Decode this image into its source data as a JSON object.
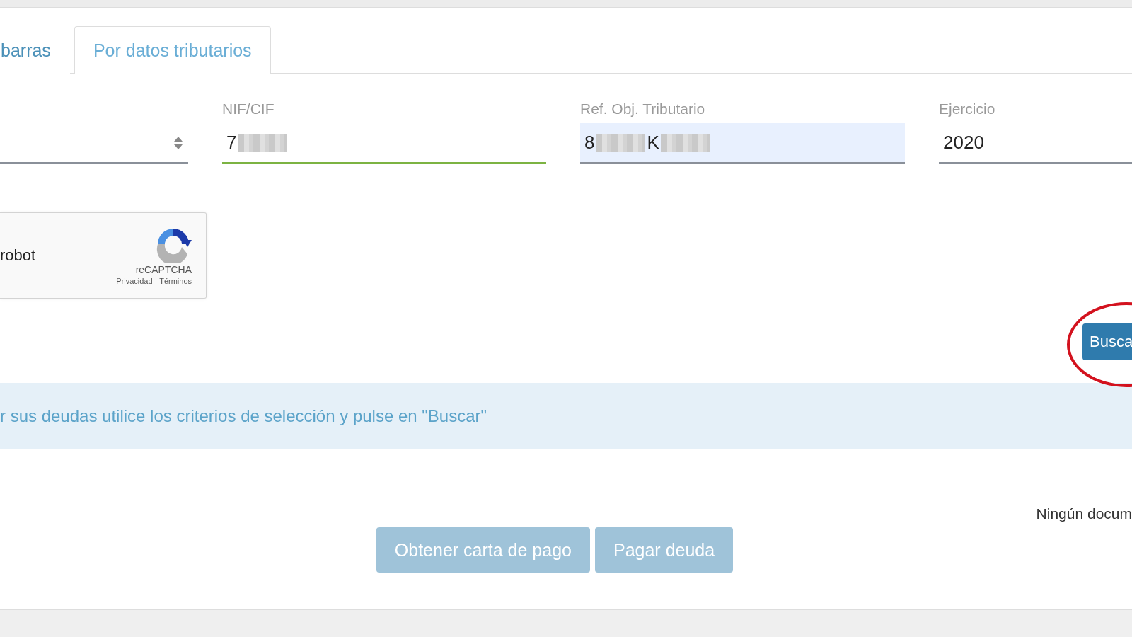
{
  "tabs": [
    {
      "label": "barras",
      "selected": false
    },
    {
      "label": "Por datos tributarios",
      "selected": true
    }
  ],
  "fields": [
    {
      "kind": "select",
      "valid": false,
      "focused": false
    },
    {
      "kind": "input",
      "label": "NIF/CIF",
      "valid": true,
      "focused": false,
      "segments": [
        {
          "kind": "text",
          "text": "7"
        },
        {
          "kind": "blur"
        }
      ]
    },
    {
      "kind": "input",
      "label": "Ref. Obj. Tributario",
      "valid": false,
      "focused": true,
      "segments": [
        {
          "kind": "text",
          "text": "8"
        },
        {
          "kind": "blur"
        },
        {
          "kind": "text",
          "text": "K"
        },
        {
          "kind": "blur"
        }
      ]
    },
    {
      "kind": "input",
      "label": "Ejercicio",
      "valid": false,
      "focused": false,
      "segments": [
        {
          "kind": "text",
          "text": "2020"
        }
      ]
    }
  ],
  "captcha": {
    "label": "robot",
    "brand": "reCAPTCHA",
    "privacy": "Privacidad",
    "separator": "-",
    "terms": "Términos"
  },
  "search_button": {
    "label": "Busca",
    "circled": true
  },
  "info": "r sus deudas utilice los criterios de selección y pulse en \"Buscar\"",
  "result_note": "Ningún docum",
  "actions": [
    {
      "label": "Obtener carta de pago",
      "disabled": true
    },
    {
      "label": "Pagar deuda",
      "disabled": true
    }
  ]
}
